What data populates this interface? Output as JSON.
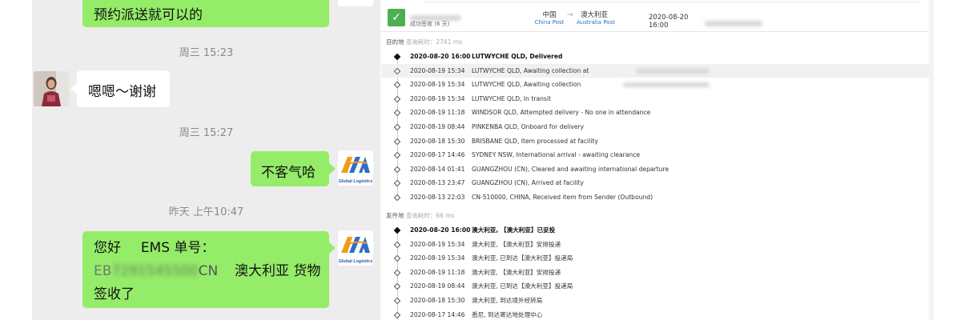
{
  "chat": {
    "messages": [
      {
        "text": "预约派送就可以的"
      },
      {
        "text": "嗯嗯～谢谢"
      },
      {
        "text": "不客气哈"
      },
      {
        "line1_a": "您好",
        "line1_b": "EMS 单号：",
        "tracking_prefix": "EB",
        "tracking_suffix": "CN",
        "line2_rest": "澳大利亚  货物",
        "line3": "签收了"
      }
    ],
    "timestamps": [
      "周三 15:23",
      "周三 15:27",
      "昨天 上午10:47"
    ],
    "logo_caption": "Global Logistics",
    "logo_letters": "GLA",
    "colors": {
      "green_bubble": "#95ec69",
      "chat_bg": "#ededed"
    }
  },
  "tracking": {
    "header": {
      "status_text": "成功签收 (6 天)",
      "origin_country": "中国",
      "origin_carrier": "China Post",
      "dest_country": "澳大利亚",
      "dest_carrier": "Australia Post",
      "delivered_time": "2020-08-20 16:00"
    },
    "destination_section": {
      "label": "目的地",
      "query_time": "查询耗时：2741 ms"
    },
    "destination_events": [
      {
        "date": "2020-08-20 16:00",
        "desc": "LUTWYCHE QLD, Delivered"
      },
      {
        "date": "2020-08-19 15:34",
        "desc": "LUTWYCHE QLD, Awaiting collection at"
      },
      {
        "date": "2020-08-19 15:34",
        "desc": "LUTWYCHE QLD, Awaiting collection"
      },
      {
        "date": "2020-08-19 15:34",
        "desc": "LUTWYCHE QLD, In transit"
      },
      {
        "date": "2020-08-19 11:18",
        "desc": "WINDSOR QLD, Attempted delivery - No one in attendance"
      },
      {
        "date": "2020-08-19 08:44",
        "desc": "PINKENBA QLD, Onboard for delivery"
      },
      {
        "date": "2020-08-18 15:30",
        "desc": "BRISBANE QLD, Item processed at facility"
      },
      {
        "date": "2020-08-17 14:46",
        "desc": "SYDNEY NSW, International arrival - awaiting clearance"
      },
      {
        "date": "2020-08-14 01:41",
        "desc": "GUANGZHOU (CN), Cleared and awaiting international departure"
      },
      {
        "date": "2020-08-13 23:47",
        "desc": "GUANGZHOU (CN), Arrived at facility"
      },
      {
        "date": "2020-08-13 22:03",
        "desc": "CN-510000, CHINA, Received item from Sender (Outbound)"
      }
    ],
    "origin_section": {
      "label": "发件地",
      "query_time": "查询耗时：66 ms"
    },
    "origin_events": [
      {
        "date": "2020-08-20 16:00",
        "desc": "澳大利亚, 【澳大利亚】已妥投"
      },
      {
        "date": "2020-08-19 15:34",
        "desc": "澳大利亚, 【澳大利亚】安排投递"
      },
      {
        "date": "2020-08-19 15:34",
        "desc": "澳大利亚, 已到达【澳大利亚】投递局"
      },
      {
        "date": "2020-08-19 11:18",
        "desc": "澳大利亚, 【澳大利亚】安排投递"
      },
      {
        "date": "2020-08-19 08:44",
        "desc": "澳大利亚, 已到达【澳大利亚】投递局"
      },
      {
        "date": "2020-08-18 15:30",
        "desc": "澳大利亚, 到达境外经转局"
      },
      {
        "date": "2020-08-17 14:46",
        "desc": "悉尼, 到达寄达地处理中心"
      }
    ]
  }
}
